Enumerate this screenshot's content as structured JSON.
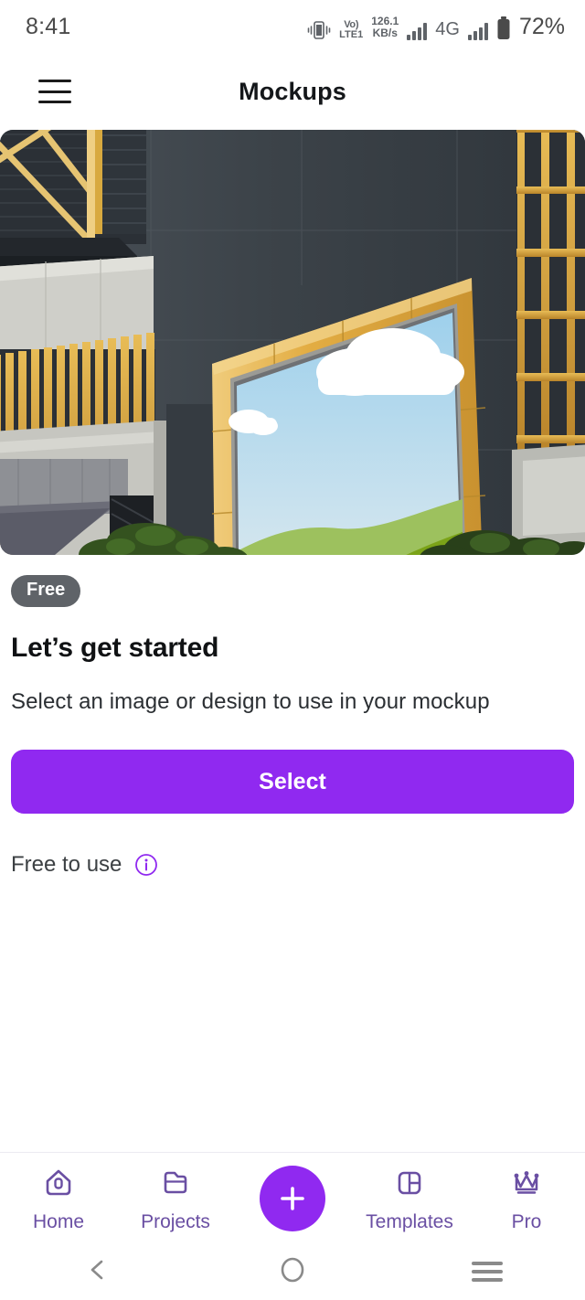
{
  "status_bar": {
    "time": "8:41",
    "volte_top": "Vo)",
    "volte_bottom": "LTE1",
    "net_speed_value": "126.1",
    "net_speed_unit": "KB/s",
    "network_type": "4G",
    "battery_percent": "72%",
    "icons": [
      "vibrate-icon",
      "volte-icon",
      "signal-bars-icon",
      "signal-bars-secondary-icon",
      "battery-icon"
    ]
  },
  "header": {
    "menu_icon": "hamburger-menu-icon",
    "title": "Mockups"
  },
  "hero": {
    "name": "billboard-mockup-preview",
    "description": "Photo of a gold-framed billboard on a dark grey building facade showing a blue sky and green hills placeholder design",
    "colors": {
      "wall_dark": "#3f464d",
      "wall_mid": "#474e55",
      "frame_gold": "#e0a93f",
      "frame_gold_light": "#eec267",
      "slats_gold": "#d9a13a",
      "concrete_light": "#c9c9c4",
      "sky_top": "#a8d4ee",
      "sky_bottom": "#d9e8f0",
      "cloud": "#ffffff",
      "hill_light": "#9dc15e",
      "hill_dark": "#7ba318",
      "awning_navy": "#474b60",
      "foliage": "#2f4a1f"
    }
  },
  "main": {
    "badge": "Free",
    "headline": "Let’s get started",
    "subhead": "Select an image or design to use in your mockup",
    "select_label": "Select",
    "select_color": "#9029f0",
    "free_to_use_label": "Free to use",
    "info_icon": "info-circle-icon",
    "info_icon_color": "#9029f0"
  },
  "bottom_nav": {
    "accent": "#6a4fa3",
    "fab_color": "#9029f0",
    "items": [
      {
        "label": "Home",
        "icon": "home-icon"
      },
      {
        "label": "Projects",
        "icon": "folder-icon"
      },
      {
        "label": "Templates",
        "icon": "layout-panels-icon"
      },
      {
        "label": "Pro",
        "icon": "crown-icon"
      }
    ],
    "fab": {
      "label": "+",
      "icon": "plus-icon"
    }
  },
  "system_nav": {
    "back": "back-chevron-icon",
    "home": "home-circle-icon",
    "recents": "recents-lines-icon"
  }
}
